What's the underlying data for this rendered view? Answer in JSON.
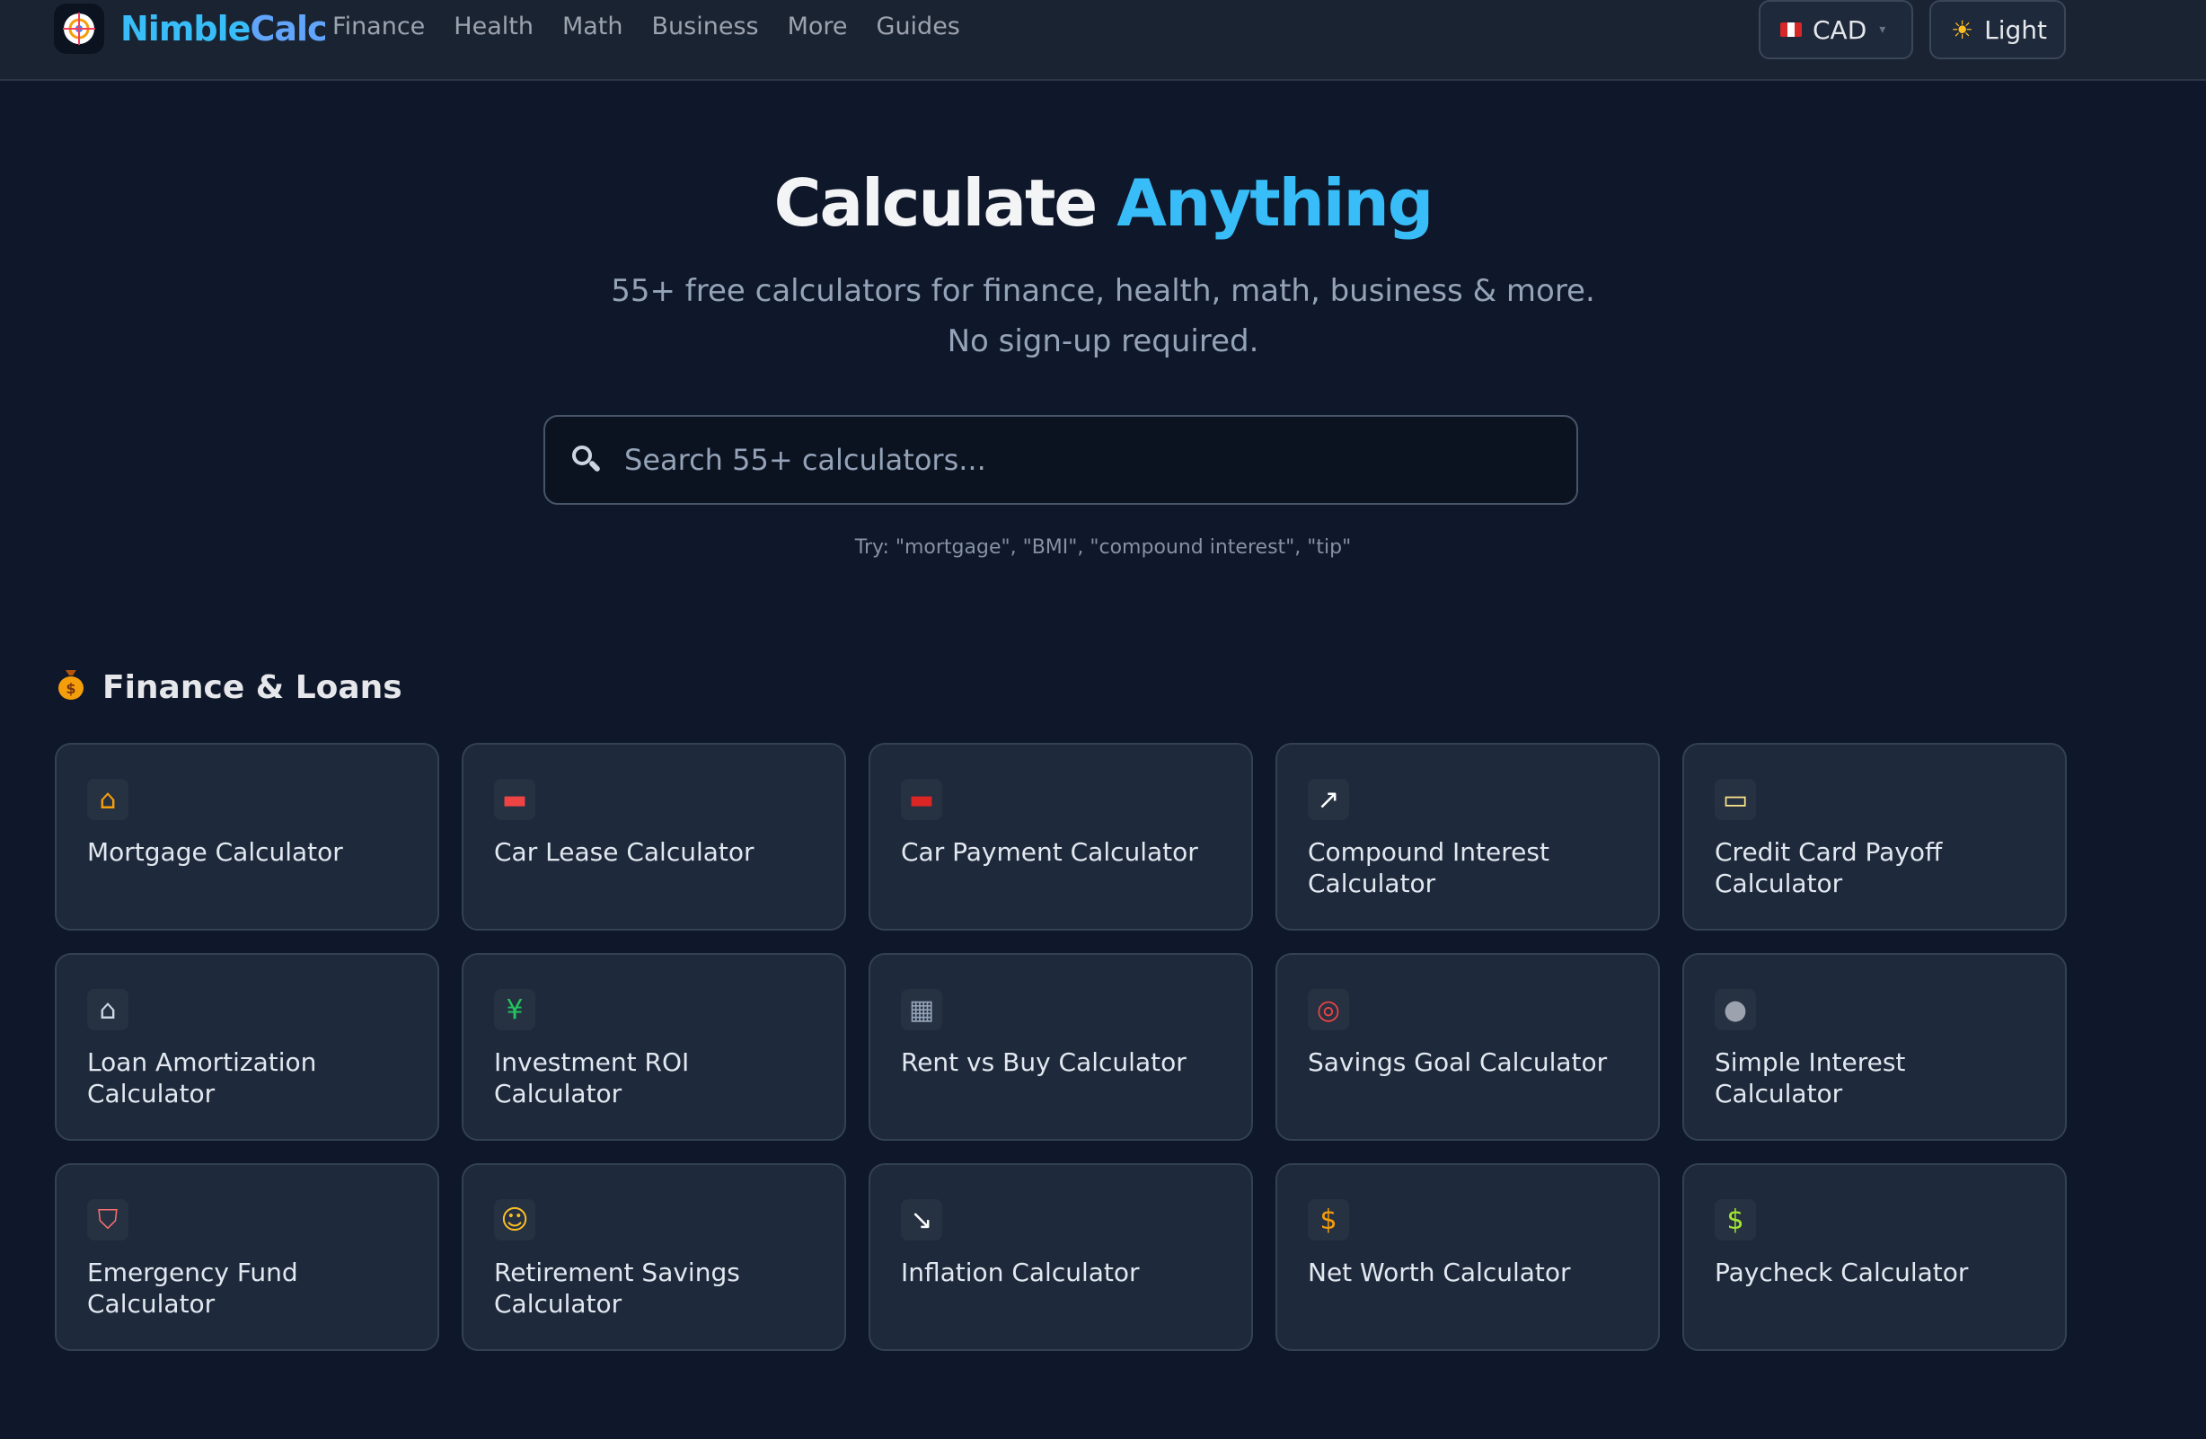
{
  "header": {
    "brand_part1": "Nimble",
    "brand_part2": "Calc",
    "nav": [
      "Finance",
      "Health",
      "Math",
      "Business",
      "More",
      "Guides"
    ],
    "currency": "CAD",
    "theme_toggle": "Light"
  },
  "hero": {
    "title_main": "Calculate",
    "title_accent": "Anything",
    "subtitle": "55+ free calculators for finance, health, math, business & more. No sign-up required.",
    "search_placeholder": "Search 55+ calculators...",
    "search_hint": "Try: \"mortgage\", \"BMI\", \"compound interest\", \"tip\""
  },
  "section": {
    "title": "Finance & Loans",
    "icon": "money-bag-icon",
    "cards": [
      {
        "label": "Mortgage Calculator",
        "icon": "house-icon",
        "color": "#f59e0b"
      },
      {
        "label": "Car Lease Calculator",
        "icon": "car-front-icon",
        "color": "#ef4444"
      },
      {
        "label": "Car Payment Calculator",
        "icon": "car-icon",
        "color": "#dc2626"
      },
      {
        "label": "Compound Interest Calculator",
        "icon": "chart-up-icon",
        "color": "#ffffff"
      },
      {
        "label": "Credit Card Payoff Calculator",
        "icon": "credit-card-icon",
        "color": "#fde68a"
      },
      {
        "label": "Loan Amortization Calculator",
        "icon": "bank-icon",
        "color": "#cbd5e1"
      },
      {
        "label": "Investment ROI Calculator",
        "icon": "yen-chart-icon",
        "color": "#22c55e"
      },
      {
        "label": "Rent vs Buy Calculator",
        "icon": "office-building-icon",
        "color": "#94a3b8"
      },
      {
        "label": "Savings Goal Calculator",
        "icon": "target-icon",
        "color": "#ef4444"
      },
      {
        "label": "Simple Interest Calculator",
        "icon": "coin-icon",
        "color": "#9ca3af"
      },
      {
        "label": "Emergency Fund Calculator",
        "icon": "shield-icon",
        "color": "#f87171"
      },
      {
        "label": "Retirement Savings Calculator",
        "icon": "older-person-icon",
        "color": "#fbbf24"
      },
      {
        "label": "Inflation Calculator",
        "icon": "chart-down-icon",
        "color": "#ffffff"
      },
      {
        "label": "Net Worth Calculator",
        "icon": "money-bag-icon",
        "color": "#f59e0b"
      },
      {
        "label": "Paycheck Calculator",
        "icon": "dollar-bill-icon",
        "color": "#a3e635"
      }
    ]
  }
}
